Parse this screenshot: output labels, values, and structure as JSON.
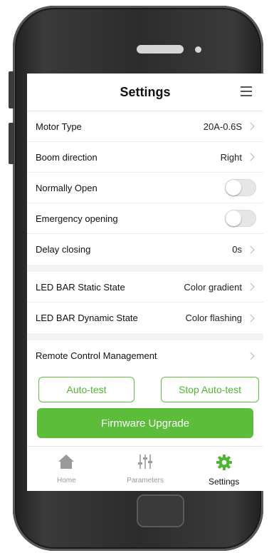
{
  "header": {
    "title": "Settings",
    "menu_icon": "hamburger-menu-icon"
  },
  "settings_rows": [
    {
      "label": "Motor Type",
      "value": "20A-0.6S",
      "type": "link"
    },
    {
      "label": "Boom direction",
      "value": "Right",
      "type": "link"
    },
    {
      "label": "Normally Open",
      "type": "toggle",
      "on": false
    },
    {
      "label": "Emergency opening",
      "type": "toggle",
      "on": false
    },
    {
      "label": "Delay closing",
      "value": "0s",
      "type": "link"
    }
  ],
  "led_rows": [
    {
      "label": "LED BAR Static State",
      "value": "Color gradient"
    },
    {
      "label": "LED BAR Dynamic State",
      "value": "Color flashing"
    }
  ],
  "remote_row": {
    "label": "Remote Control Management"
  },
  "buttons": {
    "auto_test": "Auto-test",
    "stop_auto_test": "Stop Auto-test",
    "firmware_upgrade": "Firmware Upgrade"
  },
  "tabs": [
    {
      "label": "Home",
      "icon": "home-icon"
    },
    {
      "label": "Parameters",
      "icon": "sliders-icon"
    },
    {
      "label": "Settings",
      "icon": "gear-icon",
      "active": true
    }
  ],
  "colors": {
    "accent": "#5bbd3a",
    "inactive": "#9a9a9a"
  }
}
